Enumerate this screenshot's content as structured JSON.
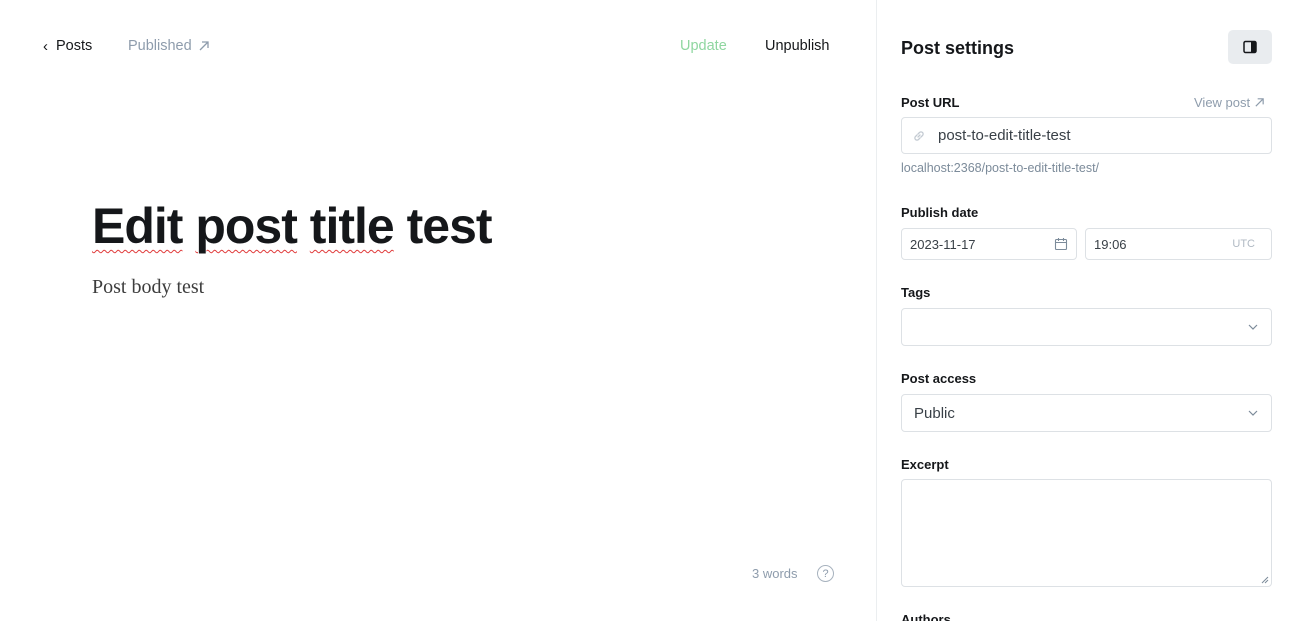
{
  "header": {
    "back_label": "Posts",
    "status_label": "Published",
    "update_label": "Update",
    "unpublish_label": "Unpublish"
  },
  "editor": {
    "title_words": [
      "Edit",
      "post",
      "title",
      "test"
    ],
    "body": "Post body test",
    "word_count": "3 words",
    "help_glyph": "?"
  },
  "settings": {
    "title": "Post settings",
    "post_url_label": "Post URL",
    "view_post_label": "View post",
    "post_url_value": "post-to-edit-title-test",
    "post_url_full": "localhost:2368/post-to-edit-title-test/",
    "publish_date_label": "Publish date",
    "publish_date": "2023-11-17",
    "publish_time": "19:06",
    "timezone": "UTC",
    "tags_label": "Tags",
    "post_access_label": "Post access",
    "post_access_value": "Public",
    "excerpt_label": "Excerpt",
    "authors_label": "Authors"
  },
  "colors": {
    "update_green": "#8fd6a0",
    "muted": "#8e9cac",
    "spellcheck_red": "#e03a3a"
  },
  "icons": [
    "chevron-left-icon",
    "external-link-icon",
    "sidebar-toggle-icon",
    "link-icon",
    "calendar-icon",
    "chevron-down-icon",
    "help-icon"
  ]
}
